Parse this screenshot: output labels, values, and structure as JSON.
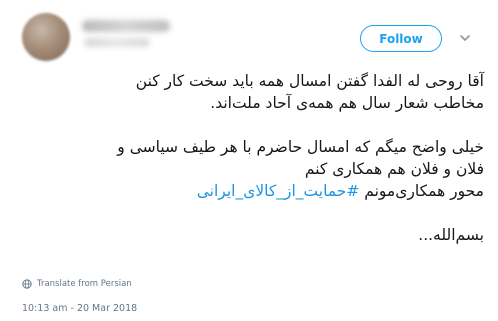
{
  "tweet": {
    "follow_label": "Follow",
    "lines": [
      "آقا روحی له الفدا گفتن امسال همه باید سخت کار کنن",
      "مخاطب شعار سال هم همه‌ی آحاد ملت‌اند.",
      "",
      "خیلی واضح میگم که امسال حاضرم با هر طیف سیاسی و",
      "فلان و فلان هم همکاری کنم"
    ],
    "last_line_prefix": "محور همکاری‌مونم ",
    "hashtag": "#حمایت_از_کالای_ایرانی",
    "closing": "بسم‌الله...",
    "translate_label": "Translate from Persian",
    "timestamp": "10:13 am - 20 Mar 2018"
  },
  "colors": {
    "accent": "#1da1f2",
    "hashtag": "#1b95e0",
    "muted": "#657786",
    "text": "#14171a"
  },
  "icons": {
    "chevron": "chevron-down-icon",
    "translate": "globe-icon"
  }
}
